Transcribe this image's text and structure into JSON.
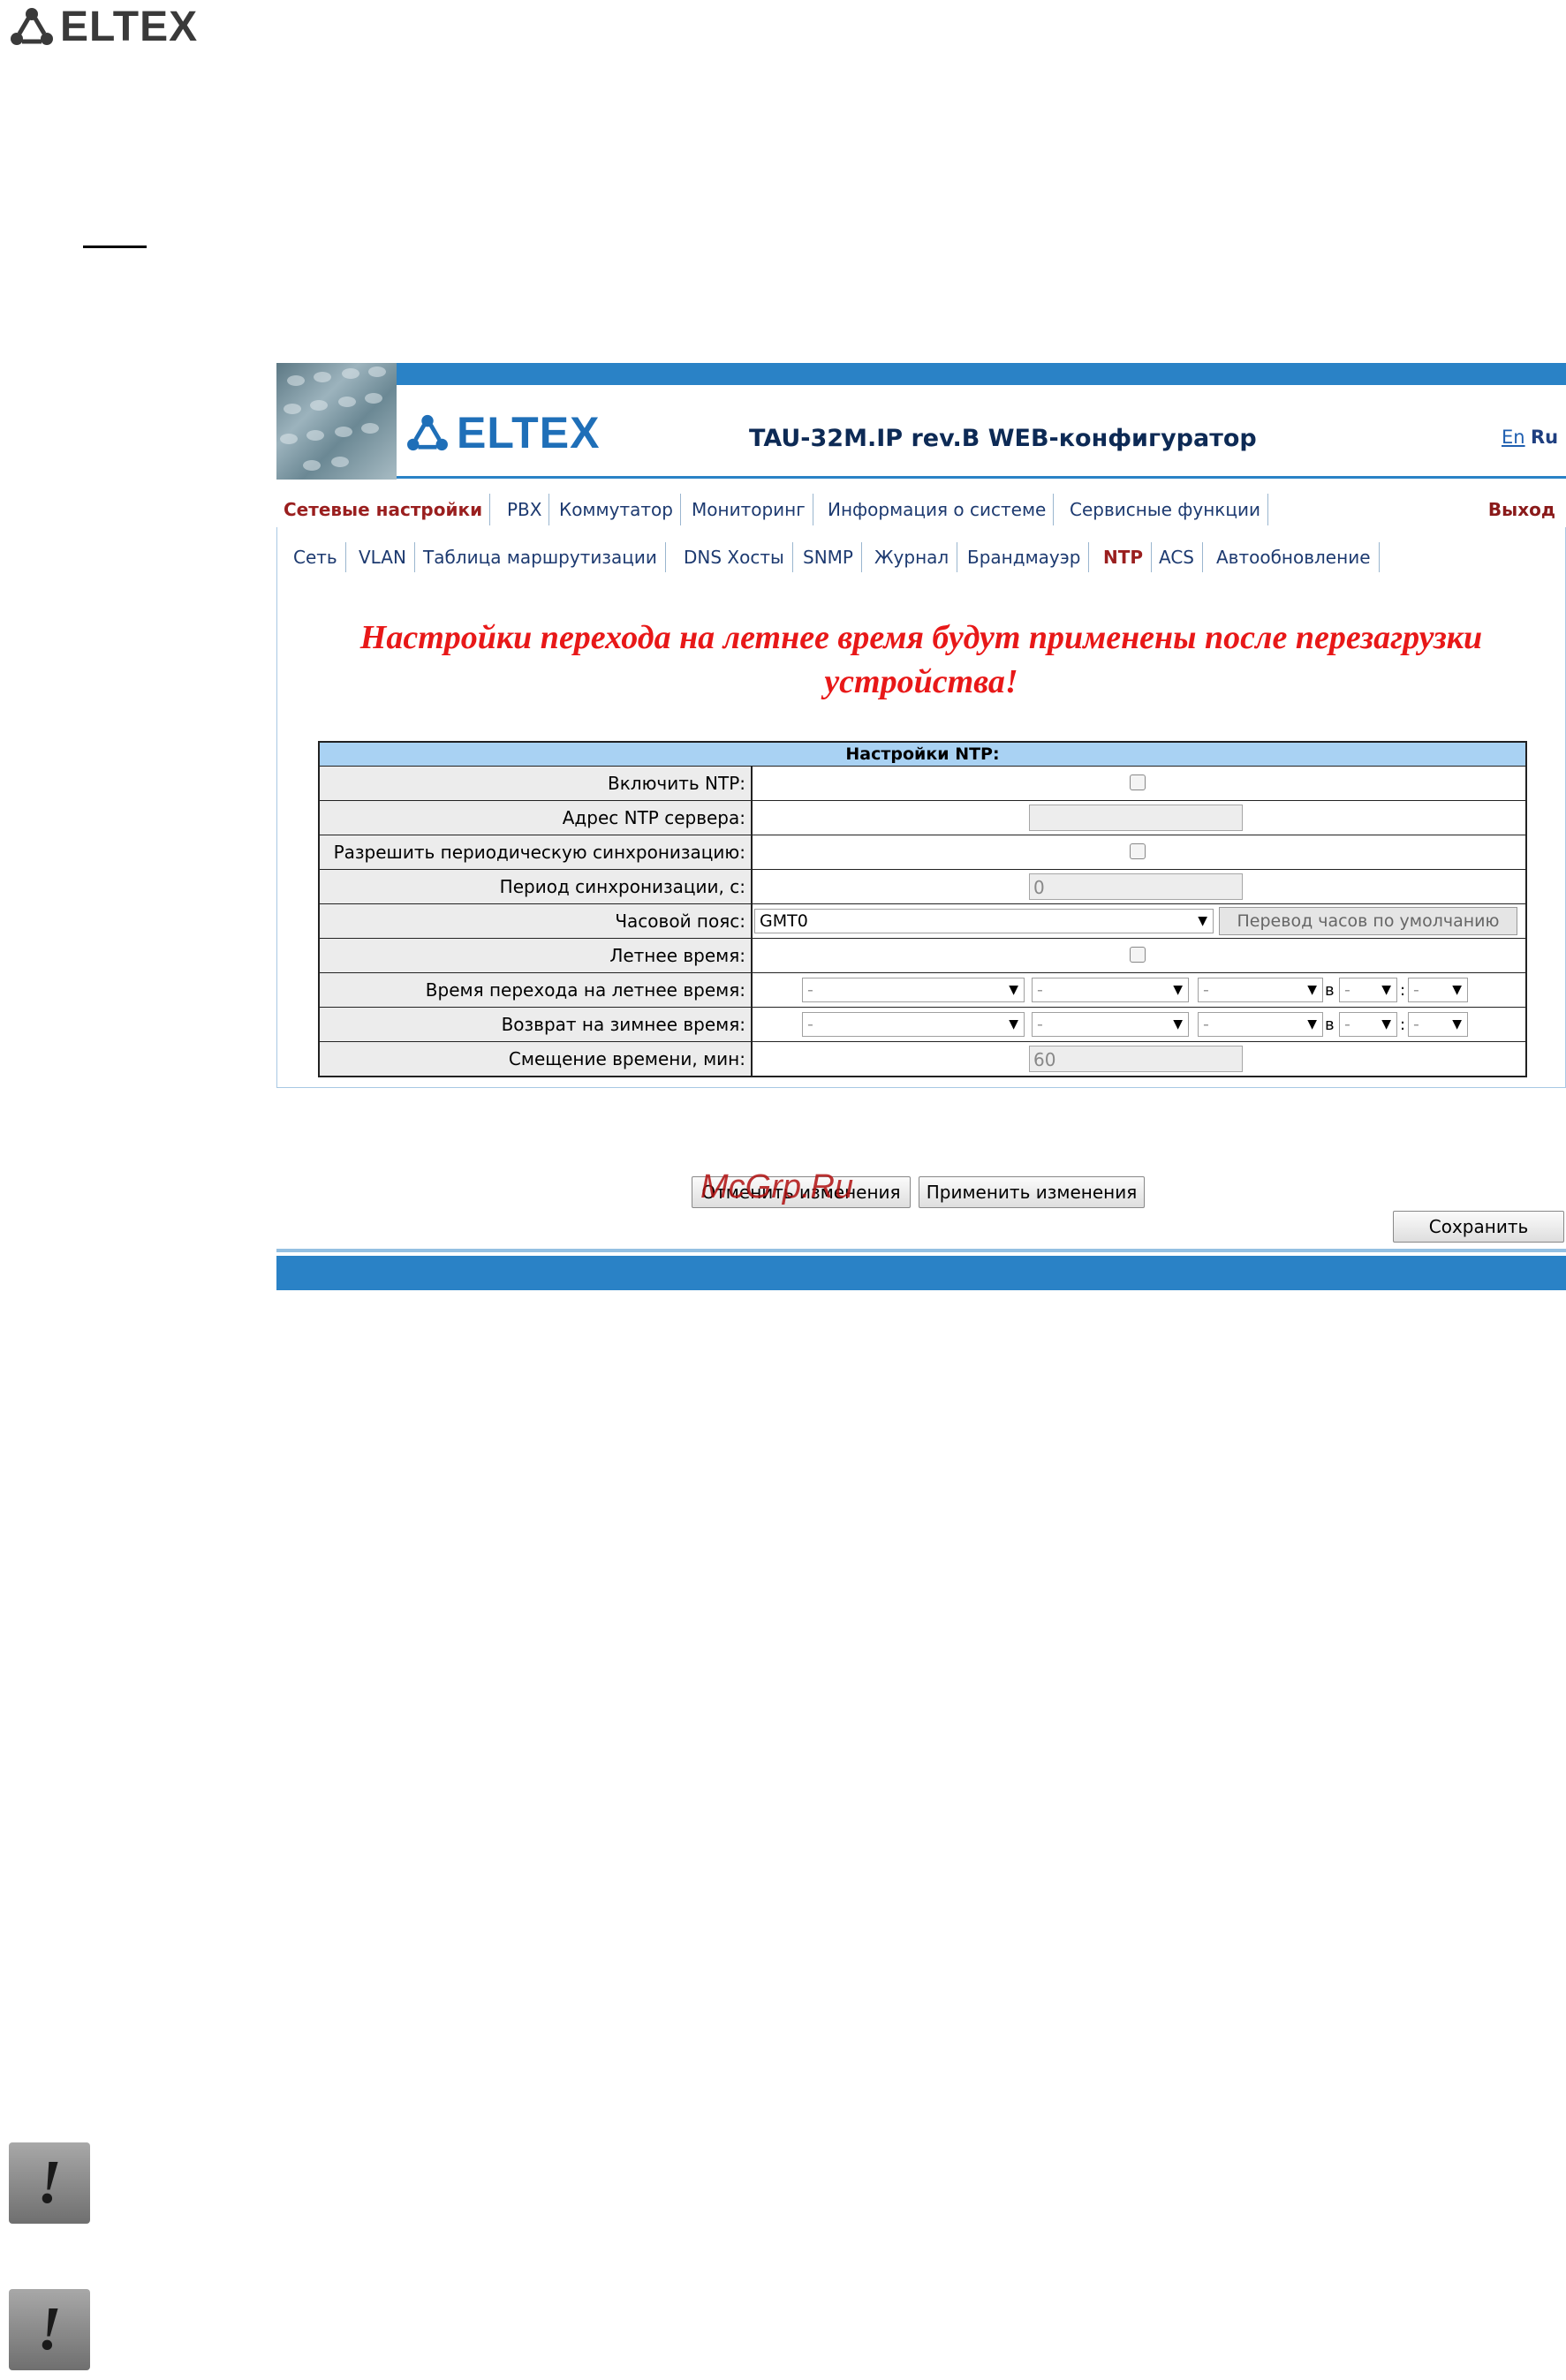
{
  "doc": {
    "logo_text": "ELTEX"
  },
  "header": {
    "logo_text": "ELTEX",
    "title": "TAU-32M.IP rev.B WEB-конфигуратор",
    "lang_en": "En",
    "lang_ru": "Ru",
    "colors": {
      "band": "#2a82c6",
      "tab_active": "#9a1f1f",
      "warning": "#e81818",
      "table_header": "#a9d2f3"
    }
  },
  "tabs": [
    {
      "label": "Сетевые настройки",
      "active": true
    },
    {
      "label": "PBX"
    },
    {
      "label": "Коммутатор"
    },
    {
      "label": "Мониторинг"
    },
    {
      "label": "Информация о системе"
    },
    {
      "label": "Сервисные функции"
    }
  ],
  "exit_label": "Выход",
  "subtabs": [
    {
      "label": "Сеть"
    },
    {
      "label": "VLAN"
    },
    {
      "label": "Таблица маршрутизации"
    },
    {
      "label": "DNS Хосты"
    },
    {
      "label": "SNMP"
    },
    {
      "label": "Журнал"
    },
    {
      "label": "Брандмауэр"
    },
    {
      "label": "NTP",
      "active": true
    },
    {
      "label": "ACS"
    },
    {
      "label": "Автообновление"
    }
  ],
  "warning": "Настройки перехода на летнее время будут применены после перезагрузки устройства!",
  "ntp": {
    "header": "Настройки NTP:",
    "enable_label": "Включить NTP:",
    "server_label": "Адрес NTP сервера:",
    "server_value": "",
    "periodic_label": "Разрешить периодическую синхронизацию:",
    "period_label": "Период синхронизации, с:",
    "period_value": "0",
    "timezone_label": "Часовой пояс:",
    "timezone_value": "GMT0",
    "default_button": "Перевод часов по умолчанию",
    "dst_label": "Летнее время:",
    "dst_start_label": "Время перехода на летнее время:",
    "dst_end_label": "Возврат на зимнее время:",
    "offset_label": "Смещение времени, мин:",
    "offset_value": "60",
    "dash": "-",
    "at": "в",
    "colon": ":"
  },
  "buttons": {
    "cancel": "Отменить изменения",
    "apply": "Применить изменения",
    "save": "Сохранить"
  },
  "watermark": "McGrp.Ru",
  "icons": {
    "warn": "!"
  }
}
